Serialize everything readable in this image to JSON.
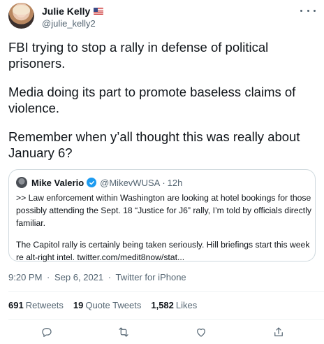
{
  "author": {
    "name": "Julie Kelly",
    "handle": "@julie_kelly2"
  },
  "tweet": {
    "paragraphs": [
      "FBI trying to stop a rally in defense of political prisoners.",
      "Media doing its part to promote baseless claims of violence.",
      "Remember when y’all thought this was really about January 6?"
    ]
  },
  "quote": {
    "name": "Mike Valerio",
    "handle": "@MikevWUSA",
    "separator": "·",
    "time": "12h",
    "paragraphs": [
      ">> Law enforcement within Washington are looking at hotel bookings for those possibly attending the Sept. 18 “Justice for J6” rally, I’m told by officials directly familiar.",
      "The Capitol rally is certainly being taken seriously. Hill briefings start this week re alt-right intel. twitter.com/medit8now/stat..."
    ]
  },
  "meta": {
    "time": "9:20 PM",
    "separator": "·",
    "date": "Sep 6, 2021",
    "source": "Twitter for iPhone"
  },
  "stats": {
    "retweets_count": "691",
    "retweets_label": "Retweets",
    "quotes_count": "19",
    "quotes_label": "Quote Tweets",
    "likes_count": "1,582",
    "likes_label": "Likes"
  },
  "colors": {
    "text": "#0f1419",
    "secondary": "#536471",
    "verified": "#1d9bf0",
    "border": "#cfd9de"
  },
  "icons": [
    "flag-icon",
    "more-icon",
    "verified-icon",
    "reply-icon",
    "retweet-icon",
    "like-icon",
    "share-icon"
  ]
}
